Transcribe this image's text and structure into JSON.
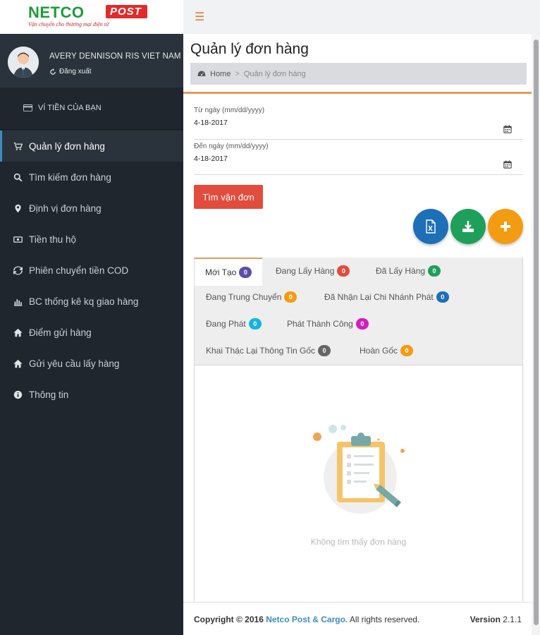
{
  "brand": {
    "name": "NETCO",
    "badge": "POST",
    "tagline": "Vận chuyển cho thương mại điện tử"
  },
  "user": {
    "name": "AVERY DENNISON RIS VIET NAM",
    "logout_label": "Đăng xuất"
  },
  "wallet": {
    "label": "VÍ TIỀN CỦA BẠN"
  },
  "sidebar": {
    "items": [
      {
        "label": "Quản lý đơn hàng",
        "icon": "cart-icon",
        "active": true
      },
      {
        "label": "Tìm kiếm đơn hàng",
        "icon": "search-icon",
        "active": false
      },
      {
        "label": "Định vị đơn hàng",
        "icon": "map-marker-icon",
        "active": false
      },
      {
        "label": "Tiền thu hộ",
        "icon": "money-icon",
        "active": false
      },
      {
        "label": "Phiên chuyển tiền COD",
        "icon": "refresh-icon",
        "active": false
      },
      {
        "label": "BC thống kê kq giao hàng",
        "icon": "bar-chart-icon",
        "active": false
      },
      {
        "label": "Điểm gửi hàng",
        "icon": "home-icon",
        "active": false
      },
      {
        "label": "Gửi yêu cầu lấy hàng",
        "icon": "home-icon",
        "active": false
      },
      {
        "label": "Thông tin",
        "icon": "info-icon",
        "active": false
      }
    ]
  },
  "page": {
    "title": "Quản lý đơn hàng",
    "breadcrumb": {
      "home": "Home",
      "current": "Quản lý đơn hàng"
    }
  },
  "filters": {
    "from_label": "Từ ngày (mm/dd/yyyy)",
    "from_value": "4-18-2017",
    "to_label": "Đến ngày (mm/dd/yyyy)",
    "to_value": "4-18-2017",
    "search_button": "Tìm vận đơn"
  },
  "tabs": [
    {
      "label": "Mới Tạo",
      "count": "0",
      "color": "#5b4fa8"
    },
    {
      "label": "Đang Lấy Hàng",
      "count": "0",
      "color": "#e14c3c"
    },
    {
      "label": "Đã Lấy Hàng",
      "count": "0",
      "color": "#1ea05a"
    },
    {
      "label": "Đang Trung Chuyển",
      "count": "0",
      "color": "#f39c12"
    },
    {
      "label": "Đã Nhận Lại Chi Nhánh Phát",
      "count": "0",
      "color": "#1d6fb8"
    },
    {
      "label": "Đang Phát",
      "count": "0",
      "color": "#17b3e0"
    },
    {
      "label": "Phát Thành Công",
      "count": "0",
      "color": "#d21fbf"
    },
    {
      "label": "Khai Thác Lại Thông Tin Gốc",
      "count": "0",
      "color": "#666666"
    },
    {
      "label": "Hoàn Gốc",
      "count": "0",
      "color": "#f39c12"
    }
  ],
  "empty": {
    "message": "Không tìm thấy đơn hàng"
  },
  "footer": {
    "copyright_prefix": "Copyright © 2016",
    "company": "Netco Post & Cargo.",
    "rights": "All rights reserved.",
    "version_label": "Version",
    "version_value": "2.1.1"
  },
  "colors": {
    "accent": "#e39b5d",
    "fab_excel": "#1d6fb8",
    "fab_download": "#1ea05a",
    "fab_add": "#f39c12"
  }
}
